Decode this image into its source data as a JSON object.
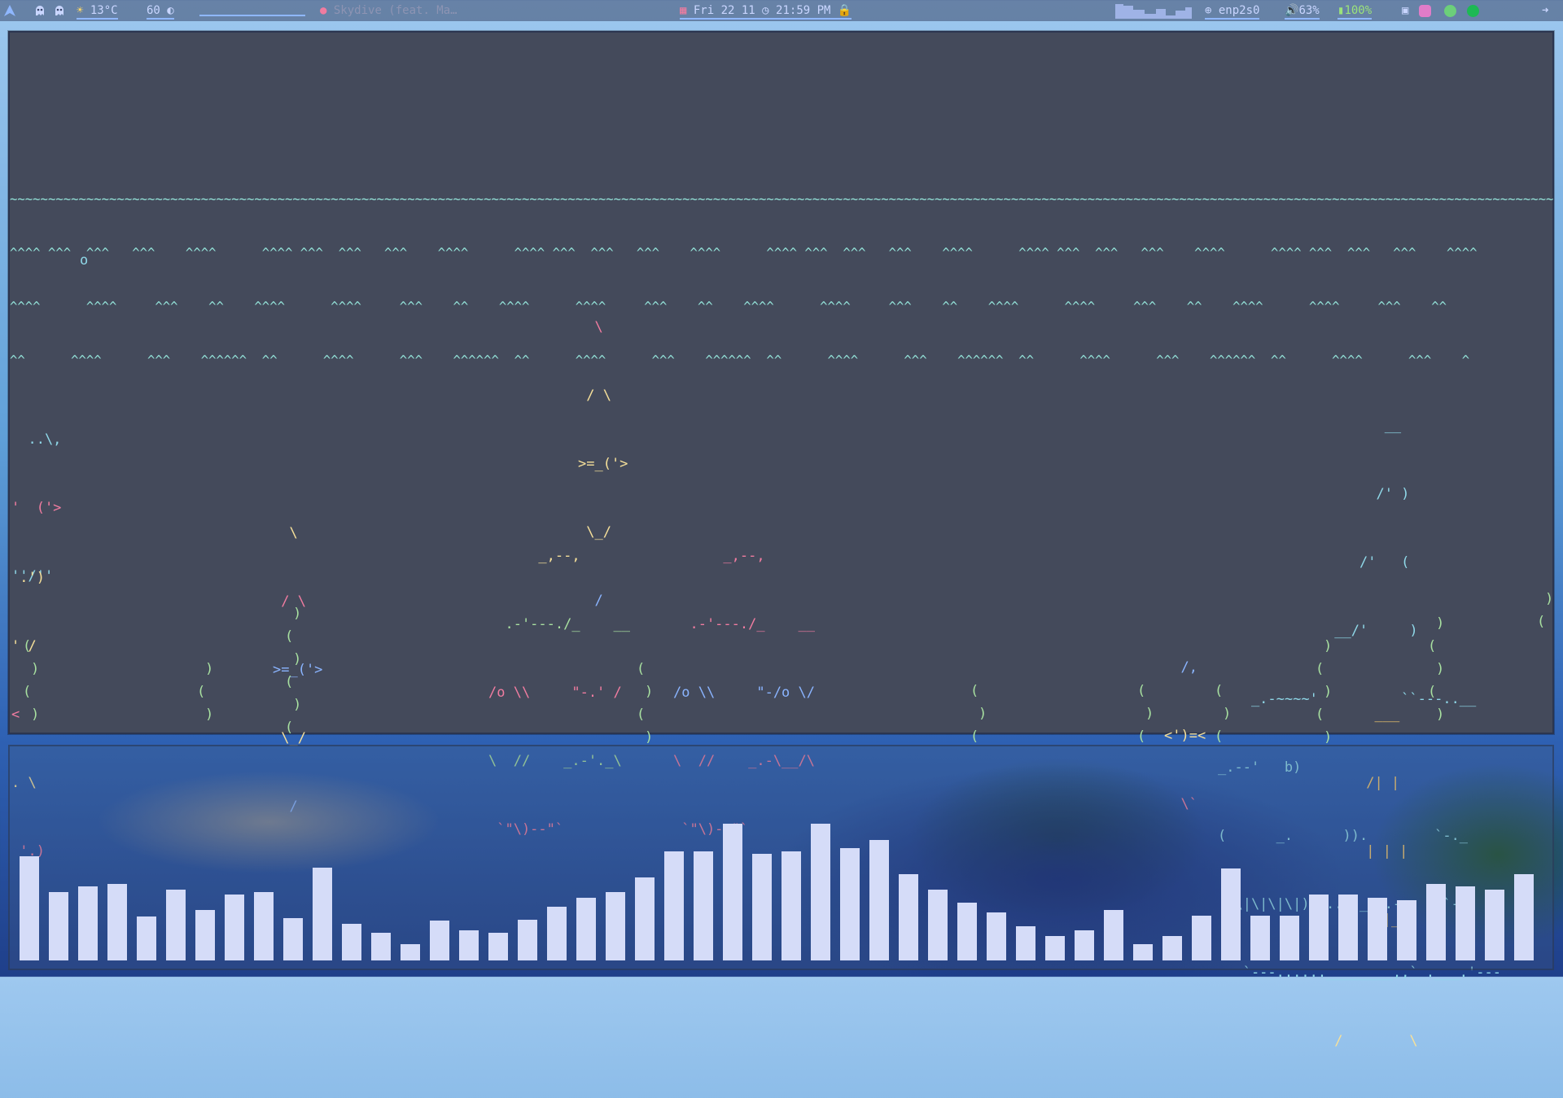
{
  "topbar": {
    "launcher_icon": "arch-logo-icon",
    "workspace_icons": [
      "ghost-icon",
      "ghost-icon"
    ],
    "weather": {
      "icon": "sun-icon",
      "text": "13°C"
    },
    "brightness": {
      "value": "60",
      "icon": "brightness-icon"
    },
    "media": {
      "icon": "music-icon",
      "title": "Skydive (feat. Ma…"
    },
    "calendar": {
      "icon": "calendar-icon",
      "date": "Fri 22 11"
    },
    "clock": {
      "icon": "clock-icon",
      "time": "21:59 PM"
    },
    "lock_icon": "lock-icon",
    "network": {
      "icon": "globe-icon",
      "interface": "enp2s0"
    },
    "volume": {
      "icon": "speaker-icon",
      "value": "63%"
    },
    "battery": {
      "icon": "battery-icon",
      "value": "100%"
    },
    "tray_icons": [
      "tray-window-icon",
      "tray-cat-icon",
      "tray-wechat-icon",
      "tray-spotify-icon"
    ],
    "power_icon": "arrow-right-icon"
  },
  "aquarium": {
    "bubble": "o",
    "waves": [
      "~~~~~~~~~~~~~~~~~~~~~~~~~~~~~~~~~~~~~~~~~~~~~~~~~~~~~~~~~~~~~~~~~~~~~~~~~~~~~~~~~~~~~~~~~~~~~~~~~~~~~~~~~~~~~~~~~~~~~~~~~~~~~~~~~~~~~~~~~~~~~~~~~~~~~~~~~~~~~~~~~~~~~~~~~~~~~~~~~~~~~~~~~~~~~~~~~~~~~~~~~~",
      "^^^^ ^^^  ^^^   ^^^    ^^^^      ^^^^ ^^^  ^^^   ^^^    ^^^^      ^^^^ ^^^  ^^^   ^^^    ^^^^      ^^^^ ^^^  ^^^   ^^^    ^^^^      ^^^^ ^^^  ^^^   ^^^    ^^^^      ^^^^ ^^^  ^^^   ^^^    ^^^^",
      "^^^^      ^^^^     ^^^    ^^    ^^^^      ^^^^     ^^^    ^^    ^^^^      ^^^^     ^^^    ^^    ^^^^      ^^^^     ^^^    ^^    ^^^^      ^^^^     ^^^    ^^    ^^^^      ^^^^     ^^^    ^^",
      "^^      ^^^^      ^^^    ^^^^^^  ^^      ^^^^      ^^^    ^^^^^^  ^^      ^^^^      ^^^    ^^^^^^  ^^      ^^^^      ^^^    ^^^^^^  ^^      ^^^^      ^^^    ^^^^^^  ^^      ^^^^      ^^^    ^"
    ],
    "fish_top": [
      "  \\",
      " / \\",
      ">=_('>",
      " \\_/",
      "  /"
    ],
    "fish_mid": [
      "  \\",
      " / \\",
      ">=_('>",
      " \\_/",
      "  /"
    ],
    "fish_left_small": [
      "  ..\\,",
      "'  ('>",
      "''/''"
    ],
    "fish_left_edge": [
      " .')",
      "' /",
      "<",
      ". \\",
      " '.)"
    ],
    "fish_big_a": [
      "      _,--,",
      "  .-'---./_    __",
      "/o \\\\     \"-.' /",
      "\\  //    _.-'._\\",
      " `\"\\)--\"`"
    ],
    "fish_big_b": [
      "      _,--,",
      "  .-'---./_    __",
      "/o \\\\     \"-/o \\/",
      "\\  //    _.-\\__/\\",
      " `\"\\)--\"`"
    ],
    "small_fish": [
      "  /,",
      "<')=<",
      "  \\`"
    ],
    "shark": [
      "                    __",
      "                   /' )",
      "                 /'   (",
      "              __/'     )",
      "    _.-~~~~'          ``---..__",
      "_.--'   b)                     ",
      "(      _.      )).        `-._",
      " `\\|\\|\\|\\|)-.....___.-     `-.",
      "   `---......________,,` .___.'---",
      "              /        \\"
    ],
    "castle": [
      "  ___",
      " /| |",
      " | | |",
      " |_|_|"
    ],
    "seaweed_tokens": [
      "(",
      ")"
    ]
  },
  "visualizer": {
    "levels": [
      0.76,
      0.5,
      0.54,
      0.56,
      0.32,
      0.52,
      0.37,
      0.48,
      0.5,
      0.31,
      0.68,
      0.27,
      0.2,
      0.12,
      0.29,
      0.22,
      0.2,
      0.3,
      0.39,
      0.46,
      0.5,
      0.61,
      0.8,
      0.8,
      1.0,
      0.78,
      0.8,
      1.0,
      0.82,
      0.88,
      0.63,
      0.52,
      0.42,
      0.35,
      0.25,
      0.18,
      0.22,
      0.37,
      0.12,
      0.18,
      0.33,
      0.67,
      0.33,
      0.33,
      0.48,
      0.48,
      0.46,
      0.44,
      0.56,
      0.54,
      0.52,
      0.63
    ]
  },
  "colors": {
    "terminal_bg": "#444a5b",
    "bar_color": "#d5dcf8",
    "wave_color": "#93e2d8"
  }
}
